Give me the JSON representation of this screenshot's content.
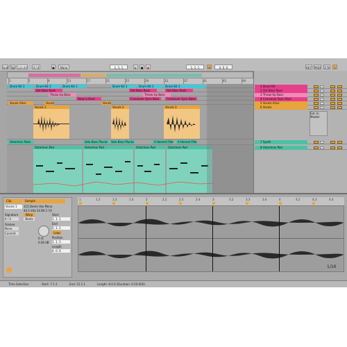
{
  "colors": {
    "orange": "#e9a43a",
    "magenta": "#e63f8c",
    "pink": "#f08bb8",
    "cyan": "#45c7d9",
    "teal": "#4fc0a4",
    "gray_panel": "#a6a6a6"
  },
  "control_bar": {
    "link": "Link",
    "tap": "Tap",
    "tempo": "120.00",
    "meter": "4 / 4",
    "quantize": "None",
    "position": "1. 1. 1",
    "key": "KEY",
    "midi": "MIDI",
    "cpu": "2 %"
  },
  "tracks": [
    {
      "name": "1 Drum Kit",
      "color": "#e63f8c"
    },
    {
      "name": "2 Ost Bass Rack",
      "color": "#e63f8c"
    },
    {
      "name": "3 Throw Up Bass",
      "color": "#f08bb8"
    },
    {
      "name": "4 Crossover Sync Bass",
      "color": "#e63f8c"
    },
    {
      "name": "5 Vocals Alice",
      "color": "#e9a43a"
    },
    {
      "name": "6 Vocals",
      "color": "#e9a43a"
    },
    {
      "name": "7 Synth",
      "color": "#4fc0a4"
    },
    {
      "name": "8 Osterhein Pad",
      "color": "#4fc0a4"
    },
    {
      "name": "A Reverb | Compre",
      "color": "#c9c9c9"
    },
    {
      "name": "B Echo",
      "color": "#c9c9c9"
    },
    {
      "name": "Master",
      "color": "#5a5a5a"
    }
  ],
  "arrangement": {
    "ruler_labels": [
      "1",
      "5",
      "9",
      "13",
      "17",
      "21",
      "25",
      "29",
      "33",
      "37",
      "41",
      "45",
      "49"
    ],
    "clips": {
      "drums": [
        "Drum Kit 1",
        "Drum Kit 1",
        "Drum Kit 1",
        "Drum Kit 1",
        "Drum Kit 1",
        "Drum Kit 1"
      ],
      "bass": [
        "Ost Bass Rack",
        "Ost Bass Rack",
        "Ost Bass Rack"
      ],
      "throw": [
        "Throw Up Bass",
        "Throw Up Bass"
      ],
      "sync": [
        "Step in Dark",
        "Crossover Sync Bass",
        "Crossover Sync Bass"
      ],
      "vocal_alice": [
        "Vocals Alice",
        "Vocals",
        "Vocals"
      ],
      "vocals": [
        "Vocals 1",
        "Vocals 2",
        "Vocals 3"
      ],
      "synth": [
        "Osterhein Pads",
        "Velo Bass Plucks",
        "Velo Bass Plucks",
        "A Honest Filte",
        "A Honest Filte"
      ],
      "pad": [
        "Osterhein Pad",
        "Osterhein Pad",
        "Osterhein Pad",
        "Osterhein Pad"
      ]
    },
    "time_labels": [
      "0:00",
      "0:20",
      "0:40",
      "1:00",
      "1:20",
      "1:40",
      "2:00"
    ]
  },
  "mixer": {
    "sends_label": "Sends",
    "io_label": "Ext. In",
    "routing_label": "Master"
  },
  "detail": {
    "clip_title": "Clip",
    "sample_title": "Sample",
    "clip_name": "Vocals 1",
    "sample_name": "115 Demo Vox Mono",
    "sample_info": "44.1 kHz 24 Bit 2 Ch",
    "warp": "Warp",
    "mode": "Beats",
    "start_label": "Start",
    "end_label": "End",
    "signature_label": "Signature",
    "sig_value": "4 / 4",
    "groove_label": "Groove",
    "groove_value": "None",
    "commit": "Commit",
    "loop_label": "Loop",
    "position_label": "Position",
    "length_label": "Length",
    "gain_value": "0.00 dB",
    "transpose": "0 st",
    "ruler": [
      "1",
      "1.2",
      "1.3",
      "1.4",
      "2",
      "2.2",
      "2.3",
      "2.4",
      "3",
      "3.2",
      "3.3",
      "3.4",
      "4",
      "4.2",
      "4.3",
      "4.4"
    ],
    "zoom": "1/16"
  },
  "status_bar": {
    "selection": "Time Selection",
    "start": "Start: 7.1.1",
    "end": "End: 15.1.1",
    "length": "Length: 8.0.0  (Duration: 0:16:000)"
  }
}
